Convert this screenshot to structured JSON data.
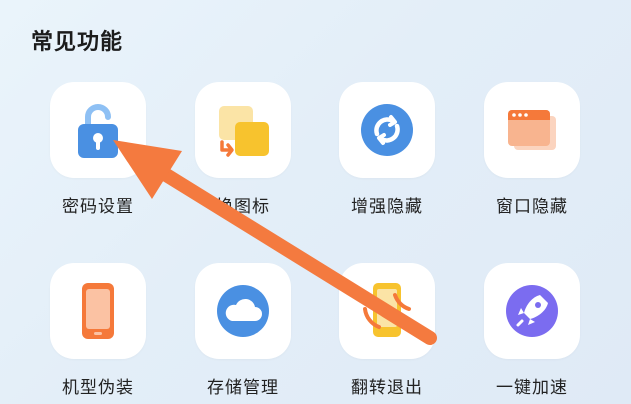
{
  "section": {
    "title": "常见功能"
  },
  "features": [
    {
      "label": "密码设置",
      "icon": "unlocked-padlock-icon"
    },
    {
      "label": "换图标",
      "label_visible": "换图标",
      "icon": "swap-icon"
    },
    {
      "label": "增强隐藏",
      "icon": "enhanced-hide-icon"
    },
    {
      "label": "窗口隐藏",
      "icon": "window-hide-icon"
    },
    {
      "label": "机型伪装",
      "icon": "phone-disguise-icon"
    },
    {
      "label": "存储管理",
      "icon": "cloud-storage-icon"
    },
    {
      "label": "翻转退出",
      "icon": "flip-exit-icon"
    },
    {
      "label": "一键加速",
      "icon": "rocket-icon"
    }
  ],
  "colors": {
    "accent_blue": "#4a90e2",
    "orange": "#f5793a",
    "yellow": "#f7c32e",
    "purple": "#7b6cf0",
    "annotation_arrow": "#f47a3f"
  }
}
